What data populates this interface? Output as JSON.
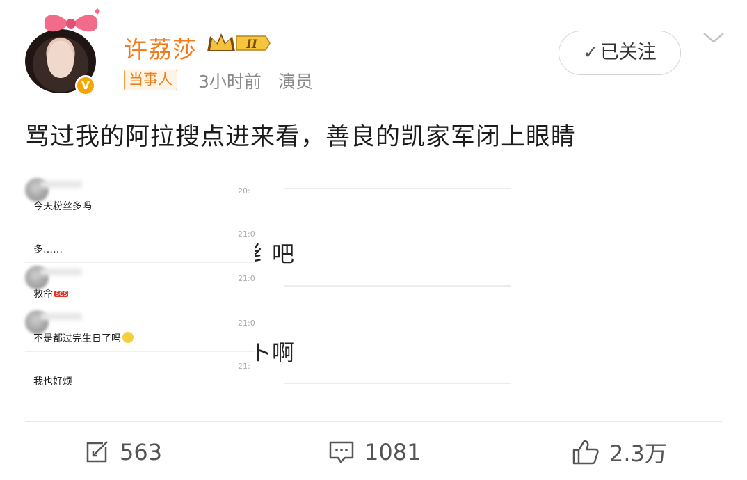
{
  "post": {
    "author": "许荔莎",
    "level_badge": "II",
    "tag": "当事人",
    "time": "3小时前",
    "role": "演员",
    "follow_label": "已关注",
    "text": "骂过我的阿拉搜点进来看，善良的凯家军闭上眼睛"
  },
  "image": {
    "background_fragments": [
      "纟吧",
      "ト啊"
    ],
    "chat": [
      {
        "time": "20:",
        "message": "今天粉丝多吗",
        "extra": ""
      },
      {
        "time": "21:0",
        "message": "多……",
        "extra": ""
      },
      {
        "time": "21:0",
        "message": "救命",
        "extra": "SOS"
      },
      {
        "time": "21:0",
        "message": "不是都过完生日了吗",
        "extra": ""
      },
      {
        "time": "21:",
        "message": "我也好烦",
        "extra": ""
      }
    ]
  },
  "actions": {
    "repost_count": "563",
    "comment_count": "1081",
    "like_count": "2.3万"
  },
  "colors": {
    "username": "#f47c1c",
    "tag_border": "#f0a04b",
    "verified_badge": "#f7a600"
  }
}
